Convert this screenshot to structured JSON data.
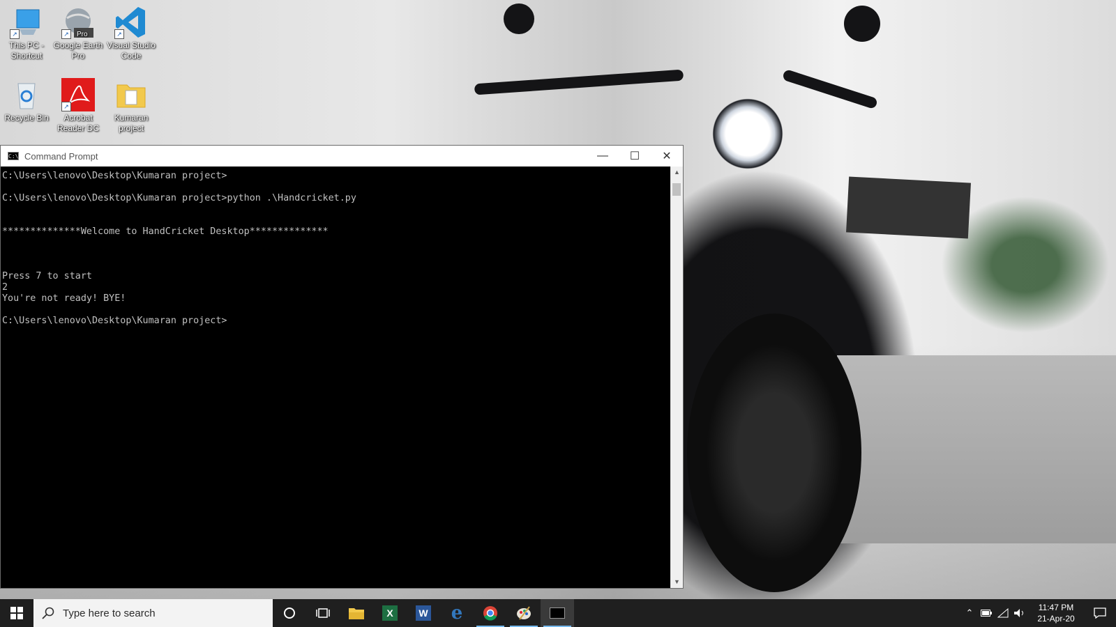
{
  "desktop": {
    "icons": [
      {
        "label": "This PC - Shortcut",
        "icon": "this-pc-icon"
      },
      {
        "label": "Google Earth Pro",
        "icon": "google-earth-icon",
        "badge": "Pro"
      },
      {
        "label": "Visual Studio Code",
        "icon": "vscode-icon"
      },
      {
        "label": "Recycle Bin",
        "icon": "recycle-bin-icon"
      },
      {
        "label": "Acrobat Reader DC",
        "icon": "acrobat-icon"
      },
      {
        "label": "Kumaran project",
        "icon": "folder-icon"
      }
    ]
  },
  "cmd": {
    "title": "Command Prompt",
    "lines": [
      "C:\\Users\\lenovo\\Desktop\\Kumaran project>",
      "",
      "C:\\Users\\lenovo\\Desktop\\Kumaran project>python .\\Handcricket.py",
      "",
      "",
      "**************Welcome to HandCricket Desktop**************",
      "",
      "",
      "",
      "Press 7 to start",
      "2",
      "You're not ready! BYE!",
      "",
      "C:\\Users\\lenovo\\Desktop\\Kumaran project>"
    ],
    "controls": {
      "minimize": "—",
      "maximize": "☐",
      "close": "✕"
    }
  },
  "taskbar": {
    "search_placeholder": "Type here to search",
    "apps": [
      {
        "name": "cortana",
        "icon": "cortana-circle-icon"
      },
      {
        "name": "task-view",
        "icon": "task-view-icon"
      },
      {
        "name": "file-explorer",
        "icon": "folder-icon"
      },
      {
        "name": "excel",
        "icon": "excel-icon",
        "glyph": "X"
      },
      {
        "name": "word",
        "icon": "word-icon",
        "glyph": "W"
      },
      {
        "name": "edge",
        "icon": "edge-icon",
        "glyph": "e"
      },
      {
        "name": "chrome",
        "icon": "chrome-icon"
      },
      {
        "name": "paint",
        "icon": "paint-icon"
      },
      {
        "name": "command-prompt",
        "icon": "cmd-icon"
      }
    ],
    "clock": {
      "time": "11:47 PM",
      "date": "21-Apr-20"
    }
  },
  "colors": {
    "taskbar_bg": "#1f1f1f",
    "active_indicator": "#76b9ed",
    "console_text": "#c0c0c0",
    "console_bg": "#000000"
  }
}
